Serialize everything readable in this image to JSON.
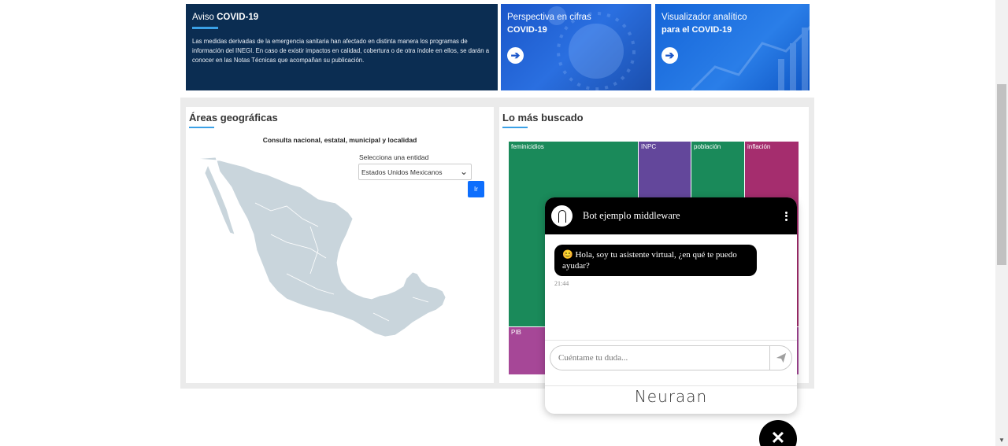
{
  "banner": {
    "aviso": {
      "title_prefix": "Aviso ",
      "title_bold": "COVID-19",
      "body": "Las medidas derivadas de la emergencia sanitaria han afectado en distinta manera los programas de información del INEGI. En caso de existir impactos en calidad, cobertura o de otra índole en ellos, se darán a conocer en las Notas Técnicas que acompañan su publicación."
    },
    "cifras": {
      "title": "Perspectiva en cifras",
      "subtitle": "COVID-19"
    },
    "visualizador": {
      "title": "Visualizador analítico",
      "subtitle": "para el COVID-19"
    },
    "arrow_icon": "arrow-right-circle-icon"
  },
  "geo": {
    "title": "Áreas geográficas",
    "heading": "Consulta nacional, estatal, municipal y localidad",
    "select_label": "Selecciona una entidad",
    "select_value": "Estados Unidos Mexicanos",
    "go_button": "Ir"
  },
  "buscado": {
    "title": "Lo más buscado",
    "treemap": [
      {
        "label": "feminicidios",
        "color": "#1a8a5a"
      },
      {
        "label": "INPC",
        "color": "#63479b"
      },
      {
        "label": "población",
        "color": "#1a8a5a"
      },
      {
        "label": "inflación",
        "color": "#a52d6e"
      },
      {
        "label": "PIB",
        "color": "#a64797"
      }
    ]
  },
  "chat": {
    "title": "Bot ejemplo middleware",
    "message": "😊 Hola, soy tu asistente virtual, ¿en qué te puedo ayudar?",
    "time": "21:44",
    "input_placeholder": "Cuéntame tu duda...",
    "brand": "Neuraan",
    "close_label": "✕"
  }
}
